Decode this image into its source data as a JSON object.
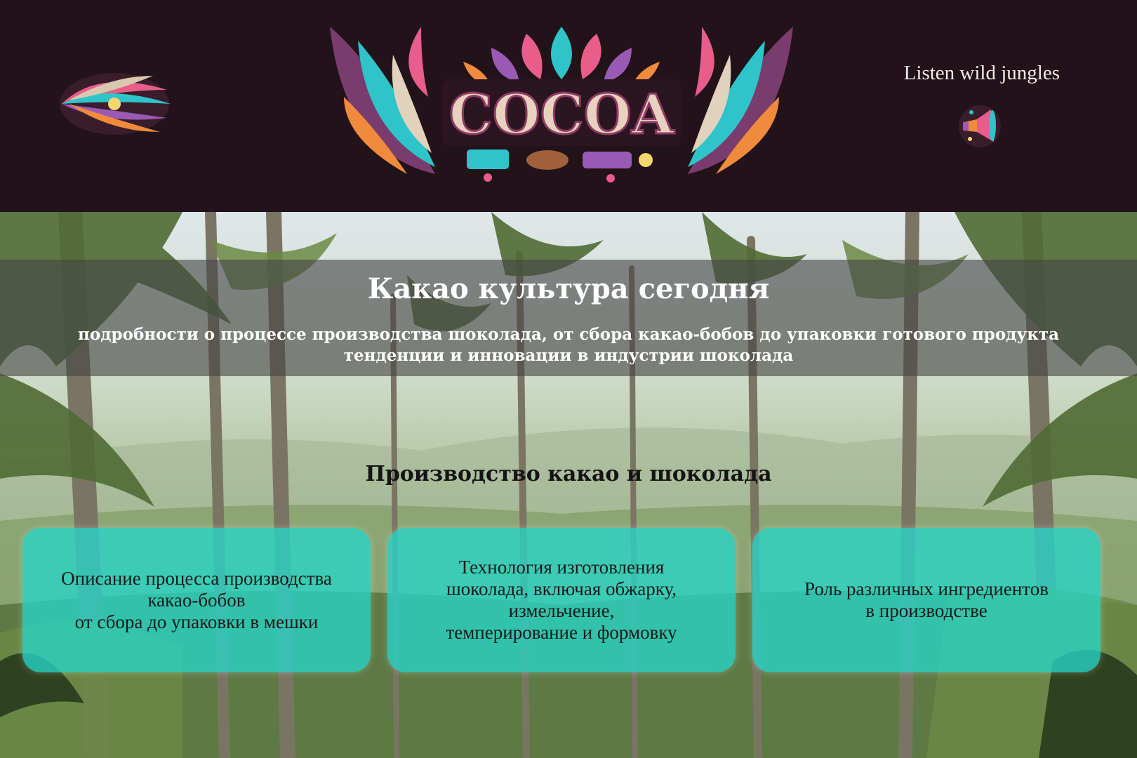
{
  "header": {
    "logo_text": "COCOA",
    "listen_label": "Listen wild jungles",
    "icons": [
      "feather-emblem-icon",
      "cocoa-logo",
      "horn-audio-icon"
    ]
  },
  "hero": {
    "title": "Какао культура сегодня",
    "subtitle_line1": "подробности о процессе производства шоколада, от сбора какао-бобов до упаковки готового продукта",
    "subtitle_line2": "тенденции и инновации в индустрии шоколада"
  },
  "section": {
    "title": "Производство какао и шоколада",
    "cards": [
      {
        "text": "Описание процесса производства\nкакао-бобов\nот сбора до упаковки в мешки"
      },
      {
        "text": "Технология изготовления\nшоколада, включая обжарку,\nизмельчение,\nтемперирование и формовку"
      },
      {
        "text": "Роль различных ингредиентов\nв производстве"
      }
    ]
  },
  "colors": {
    "header_bg": "#22121a",
    "card_bg": "#26d6c8",
    "banner_bg": "#464646"
  }
}
